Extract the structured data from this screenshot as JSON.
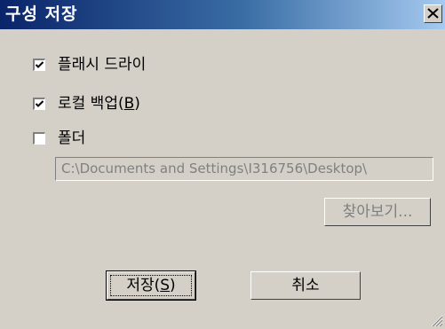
{
  "window": {
    "title": "구성 저장"
  },
  "options": {
    "flash_drive": {
      "label": "플래시 드라이",
      "checked": true
    },
    "local_backup": {
      "label_prefix": "로컬 백업(",
      "accel": "B",
      "label_suffix": ")",
      "checked": true
    },
    "folder": {
      "label": "폴더",
      "checked": false
    }
  },
  "folder_path": "C:\\Documents and Settings\\I316756\\Desktop\\",
  "buttons": {
    "browse": "찾아보기...",
    "save_prefix": "저장(",
    "save_accel": "S",
    "save_suffix": ")",
    "cancel": "취소"
  }
}
